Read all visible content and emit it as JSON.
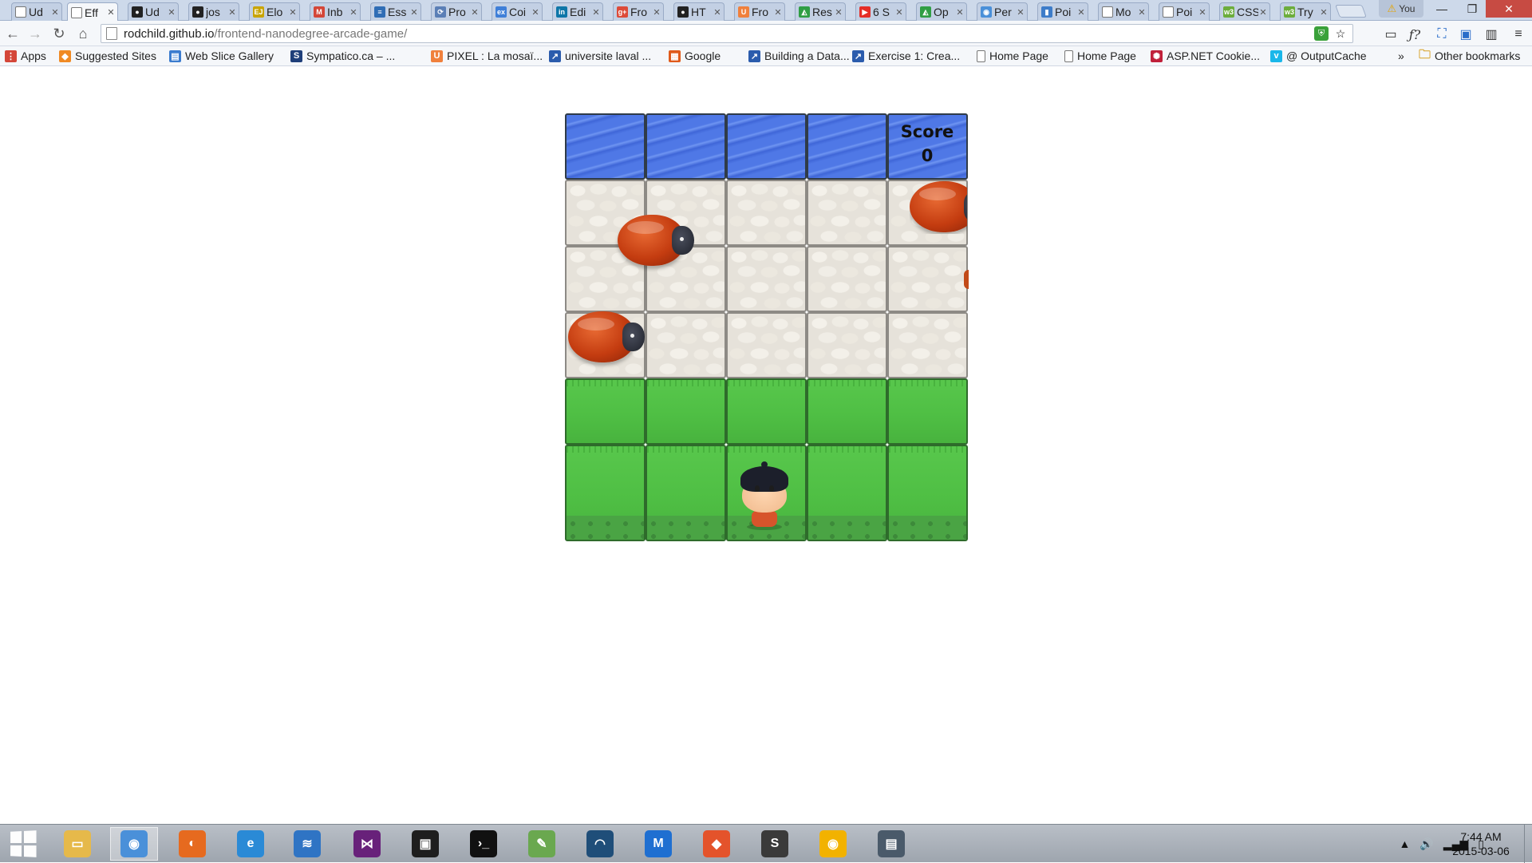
{
  "browser": {
    "tabs": [
      {
        "label": "Ud",
        "favicon": "page-icon",
        "color": "#888888",
        "glyph": ""
      },
      {
        "label": "Eff",
        "favicon": "page-icon",
        "color": "#888888",
        "glyph": "",
        "active": true
      },
      {
        "label": "Ud",
        "favicon": "github-icon",
        "color": "#222222",
        "glyph": "●"
      },
      {
        "label": "jos",
        "favicon": "github-icon",
        "color": "#222222",
        "glyph": "●"
      },
      {
        "label": "Elo",
        "favicon": "ejs-icon",
        "color": "#c9a400",
        "glyph": "EJ"
      },
      {
        "label": "Inb",
        "favicon": "gmail-icon",
        "color": "#d44638",
        "glyph": "M"
      },
      {
        "label": "Ess",
        "favicon": "doc-icon",
        "color": "#2f6db5",
        "glyph": "≡"
      },
      {
        "label": "Pro",
        "favicon": "circle-icon",
        "color": "#5b7fb6",
        "glyph": "⟳"
      },
      {
        "label": "Coi",
        "favicon": "coursera-icon",
        "color": "#3f7fd8",
        "glyph": "ex"
      },
      {
        "label": "Edi",
        "favicon": "linkedin-icon",
        "color": "#0e76a8",
        "glyph": "in"
      },
      {
        "label": "Fro",
        "favicon": "gplus-icon",
        "color": "#dd4b39",
        "glyph": "g+"
      },
      {
        "label": "HT",
        "favicon": "github-icon",
        "color": "#222222",
        "glyph": "●"
      },
      {
        "label": "Fro",
        "favicon": "udacity-icon",
        "color": "#f0803c",
        "glyph": "U"
      },
      {
        "label": "Res",
        "favicon": "drive-icon",
        "color": "#2f9e44",
        "glyph": "◭"
      },
      {
        "label": "6 S",
        "favicon": "youtube-icon",
        "color": "#e52d27",
        "glyph": "▶"
      },
      {
        "label": "Op",
        "favicon": "drive-icon",
        "color": "#2f9e44",
        "glyph": "◭"
      },
      {
        "label": "Per",
        "favicon": "chrome-icon",
        "color": "#4a90d9",
        "glyph": "◉"
      },
      {
        "label": "Poi",
        "favicon": "chart-icon",
        "color": "#3d7cc9",
        "glyph": "▮"
      },
      {
        "label": "Mo",
        "favicon": "page-icon",
        "color": "#888888",
        "glyph": ""
      },
      {
        "label": "Poi",
        "favicon": "page-icon",
        "color": "#888888",
        "glyph": ""
      },
      {
        "label": "CSS",
        "favicon": "w3c-icon",
        "color": "#6cad3c",
        "glyph": "w3"
      },
      {
        "label": "Try",
        "favicon": "w3c-icon",
        "color": "#6cad3c",
        "glyph": "w3"
      }
    ],
    "profile_label": "You",
    "url_host": "rodchild.github.io",
    "url_path": "/frontend-nanodegree-arcade-game/",
    "bookmarks": [
      {
        "label": "Apps",
        "icon": "apps-icon",
        "color": "#d44638",
        "glyph": "⋮"
      },
      {
        "label": "Suggested Sites",
        "icon": "suggested-sites-icon",
        "color": "#f08a24",
        "glyph": "◆"
      },
      {
        "label": "Web Slice Gallery",
        "icon": "web-slice-icon",
        "color": "#3b7ccf",
        "glyph": "▤"
      },
      {
        "label": "Sympatico.ca – ...",
        "icon": "sympatico-icon",
        "color": "#1f3f7a",
        "glyph": "S"
      },
      {
        "label": "PIXEL : La mosaï...",
        "icon": "udacity-icon",
        "color": "#f0803c",
        "glyph": "U"
      },
      {
        "label": "universite laval ...",
        "icon": "sharepoint-icon",
        "color": "#2b5cad",
        "glyph": "↗"
      },
      {
        "label": "Google",
        "icon": "google-apps-icon",
        "color": "#e05a1b",
        "glyph": "▦"
      },
      {
        "label": "Building a Data...",
        "icon": "sharepoint-icon",
        "color": "#2b5cad",
        "glyph": "↗"
      },
      {
        "label": "Exercise 1: Crea...",
        "icon": "sharepoint-icon",
        "color": "#2b5cad",
        "glyph": "↗"
      },
      {
        "label": "Home Page",
        "icon": "page-icon",
        "color": "#ffffff",
        "glyph": ""
      },
      {
        "label": "Home Page",
        "icon": "page-icon",
        "color": "#ffffff",
        "glyph": ""
      },
      {
        "label": "ASP.NET Cookie...",
        "icon": "aspnet-icon",
        "color": "#c0203a",
        "glyph": "✺"
      },
      {
        "label": "@ OutputCache",
        "icon": "vimeo-icon",
        "color": "#1ab7ea",
        "glyph": "v"
      }
    ],
    "bookmarks_overflow": "»",
    "other_bookmarks": "Other bookmarks"
  },
  "game": {
    "score_label": "Score",
    "score_value": "0",
    "rows": [
      "water",
      "stone",
      "stone",
      "stone",
      "grass",
      "grass"
    ],
    "columns": 5,
    "enemies": [
      {
        "name": "enemy-bug-row1-left"
      },
      {
        "name": "enemy-bug-row1-right"
      },
      {
        "name": "enemy-bug-row3"
      }
    ],
    "player": "boy-character"
  },
  "taskbar": {
    "apps": [
      {
        "name": "file-explorer-icon",
        "color": "#e6b94a",
        "glyph": "▭"
      },
      {
        "name": "chrome-icon",
        "color": "#4a90d9",
        "glyph": "◉",
        "active": true
      },
      {
        "name": "firefox-icon",
        "color": "#e66a1f",
        "glyph": "◐"
      },
      {
        "name": "internet-explorer-icon",
        "color": "#2a8ad6",
        "glyph": "e"
      },
      {
        "name": "azure-data-studio-icon",
        "color": "#2f74c4",
        "glyph": "≋"
      },
      {
        "name": "visual-studio-icon",
        "color": "#68217a",
        "glyph": "⋈"
      },
      {
        "name": "terminal-icon",
        "color": "#1e1e1e",
        "glyph": "▣"
      },
      {
        "name": "command-prompt-icon",
        "color": "#111111",
        "glyph": "›_"
      },
      {
        "name": "notepad-icon",
        "color": "#6aa84f",
        "glyph": "✎"
      },
      {
        "name": "app-window-icon",
        "color": "#1f4e79",
        "glyph": "◠"
      },
      {
        "name": "malwarebytes-icon",
        "color": "#1f6fd1",
        "glyph": "M"
      },
      {
        "name": "git-icon",
        "color": "#e4532b",
        "glyph": "◆"
      },
      {
        "name": "sublime-text-icon",
        "color": "#3a3a3a",
        "glyph": "S"
      },
      {
        "name": "chrome-canary-icon",
        "color": "#f2b200",
        "glyph": "◉"
      },
      {
        "name": "clipboard-icon",
        "color": "#4a5a6a",
        "glyph": "▤"
      }
    ],
    "time": "7:44 AM",
    "date": "2015-03-06"
  }
}
